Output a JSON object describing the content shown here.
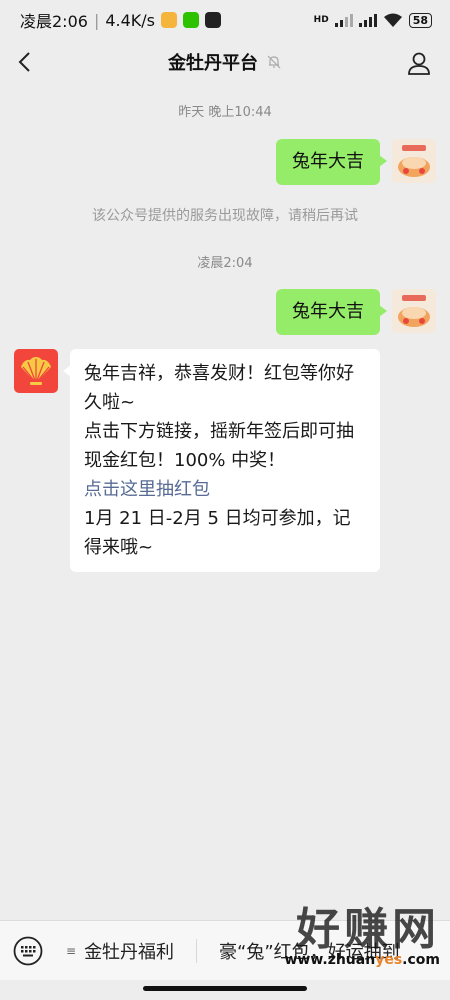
{
  "status_bar": {
    "time": "凌晨2:06",
    "speed": "4.4K/s",
    "network": "HD",
    "battery": "58"
  },
  "header": {
    "title": "金牡丹平台"
  },
  "messages": [
    {
      "type": "time",
      "text": "昨天 晚上10:44"
    },
    {
      "type": "outgoing",
      "text": "兔年大吉"
    },
    {
      "type": "system",
      "text": "该公众号提供的服务出现故障，请稍后再试"
    },
    {
      "type": "time",
      "text": "凌晨2:04"
    },
    {
      "type": "outgoing",
      "text": "兔年大吉"
    },
    {
      "type": "incoming",
      "line1": "兔年吉祥，恭喜发财！红包等你好久啦~",
      "line2": "点击下方链接，摇新年签后即可抽现金红包！100% 中奖！",
      "link": "点击这里抽红包",
      "line3": "1月 21 日-2月 5 日均可参加，记得来哦~"
    }
  ],
  "bottom_menu": {
    "item1": "金牡丹福利",
    "item2": "豪“兔”红包，好运抽到"
  },
  "watermark": {
    "brand": "好赚网",
    "url_prefix": "www.zhuan",
    "url_highlight": "yes",
    "url_suffix": ".com"
  },
  "colors": {
    "bubble_out": "#95ec69",
    "link": "#576b95",
    "background": "#ededed",
    "bot_avatar": "#f2463d"
  }
}
